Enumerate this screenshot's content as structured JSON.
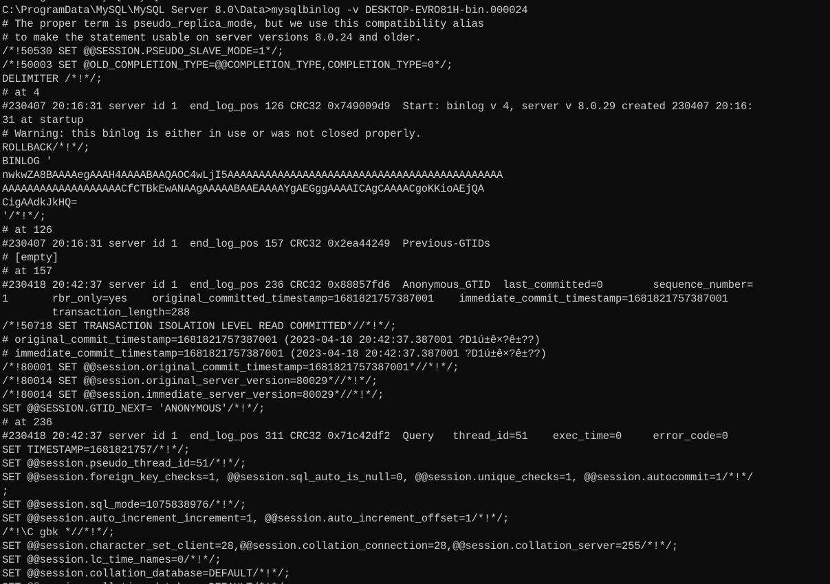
{
  "window": {
    "background": "#0c0c0c",
    "foreground": "#cccccc"
  },
  "terminal": {
    "lines": [
      "C:\\ProgramData\\MySQL\\MySQL Server 8.0\\Data>",
      "C:\\ProgramData\\MySQL\\MySQL Server 8.0\\Data>mysqlbinlog -v DESKTOP-EVRO81H-bin.000024",
      "# The proper term is pseudo_replica_mode, but we use this compatibility alias",
      "# to make the statement usable on server versions 8.0.24 and older.",
      "/*!50530 SET @@SESSION.PSEUDO_SLAVE_MODE=1*/;",
      "/*!50003 SET @OLD_COMPLETION_TYPE=@@COMPLETION_TYPE,COMPLETION_TYPE=0*/;",
      "DELIMITER /*!*/;",
      "# at 4",
      "#230407 20:16:31 server id 1  end_log_pos 126 CRC32 0x749009d9  Start: binlog v 4, server v 8.0.29 created 230407 20:16:",
      "31 at startup",
      "# Warning: this binlog is either in use or was not closed properly.",
      "ROLLBACK/*!*/;",
      "BINLOG '",
      "nwkwZA8BAAAAegAAAH4AAAABAAQAOC4wLjI5AAAAAAAAAAAAAAAAAAAAAAAAAAAAAAAAAAAAAAAAAAAA",
      "AAAAAAAAAAAAAAAAAAACfCTBkEwANAAgAAAAABAAEAAAAYgAEGggAAAAICAgCAAAACgoKKioAEjQA",
      "CigAAdkJkHQ=",
      "'/*!*/;",
      "# at 126",
      "#230407 20:16:31 server id 1  end_log_pos 157 CRC32 0x2ea44249  Previous-GTIDs",
      "# [empty]",
      "# at 157",
      "#230418 20:42:37 server id 1  end_log_pos 236 CRC32 0x88857fd6  Anonymous_GTID  last_committed=0        sequence_number=",
      "1       rbr_only=yes    original_committed_timestamp=1681821757387001    immediate_commit_timestamp=1681821757387001",
      "        transaction_length=288",
      "/*!50718 SET TRANSACTION ISOLATION LEVEL READ COMMITTED*//*!*/;",
      "# original_commit_timestamp=1681821757387001 (2023-04-18 20:42:37.387001 ?D1ú±ê×?ê±??)",
      "# immediate_commit_timestamp=1681821757387001 (2023-04-18 20:42:37.387001 ?D1ú±ê×?ê±??)",
      "/*!80001 SET @@session.original_commit_timestamp=1681821757387001*//*!*/;",
      "/*!80014 SET @@session.original_server_version=80029*//*!*/;",
      "/*!80014 SET @@session.immediate_server_version=80029*//*!*/;",
      "SET @@SESSION.GTID_NEXT= 'ANONYMOUS'/*!*/;",
      "# at 236",
      "#230418 20:42:37 server id 1  end_log_pos 311 CRC32 0x71c42df2  Query   thread_id=51    exec_time=0     error_code=0",
      "SET TIMESTAMP=1681821757/*!*/;",
      "SET @@session.pseudo_thread_id=51/*!*/;",
      "SET @@session.foreign_key_checks=1, @@session.sql_auto_is_null=0, @@session.unique_checks=1, @@session.autocommit=1/*!*/",
      ";",
      "SET @@session.sql_mode=1075838976/*!*/;",
      "SET @@session.auto_increment_increment=1, @@session.auto_increment_offset=1/*!*/;",
      "/*!\\C gbk *//*!*/;",
      "SET @@session.character_set_client=28,@@session.collation_connection=28,@@session.collation_server=255/*!*/;",
      "SET @@session.lc_time_names=0/*!*/;",
      "SET @@session.collation_database=DEFAULT/*!*/;",
      "SET @@session.collation_database=DEFAULT/*!*/;"
    ]
  }
}
